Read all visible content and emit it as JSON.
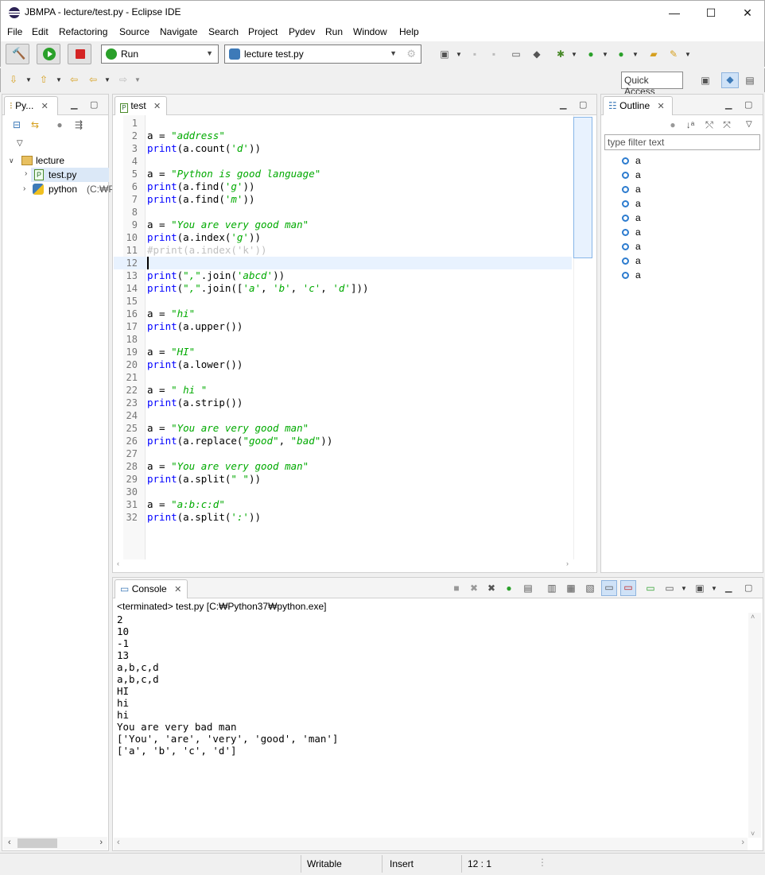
{
  "window": {
    "title": "JBMPA - lecture/test.py - Eclipse IDE",
    "minimize": "—",
    "maximize": "☐",
    "close": "✕"
  },
  "menu": [
    "File",
    "Edit",
    "Refactoring",
    "Source",
    "Navigate",
    "Search",
    "Project",
    "Pydev",
    "Run",
    "Window",
    "Help"
  ],
  "toolbar": {
    "run_config": "Run",
    "launch_target": "lecture test.py",
    "quick_access": "Quick Access"
  },
  "explorer": {
    "tab_label": "Py...",
    "project": "lecture",
    "file": "test.py",
    "interpreter": "python",
    "interpreter_path": "(C:₩P"
  },
  "editor": {
    "tab_label": "test",
    "lines": [
      {
        "n": "1",
        "src": ""
      },
      {
        "n": "2",
        "src": "a = <s>\"address\"</s>"
      },
      {
        "n": "3",
        "src": "<k>print</k>(a.count(<s>'d'</s>))"
      },
      {
        "n": "4",
        "src": ""
      },
      {
        "n": "5",
        "src": "a = <s>\"Python is good language\"</s>"
      },
      {
        "n": "6",
        "src": "<k>print</k>(a.find(<s>'g'</s>))"
      },
      {
        "n": "7",
        "src": "<k>print</k>(a.find(<s>'m'</s>))"
      },
      {
        "n": "8",
        "src": ""
      },
      {
        "n": "9",
        "src": "a = <s>\"You are very good man\"</s>"
      },
      {
        "n": "10",
        "src": "<k>print</k>(a.index(<s>'g'</s>))"
      },
      {
        "n": "11",
        "src": "<c>#print(a.index('k'))</c>"
      },
      {
        "n": "12",
        "src": ""
      },
      {
        "n": "13",
        "src": "<k>print</k>(<s>\",\"</s>.join(<s>'abcd'</s>))"
      },
      {
        "n": "14",
        "src": "<k>print</k>(<s>\",\"</s>.join([<s>'a'</s>, <s>'b'</s>, <s>'c'</s>, <s>'d'</s>]))"
      },
      {
        "n": "15",
        "src": ""
      },
      {
        "n": "16",
        "src": "a = <s>\"hi\"</s>"
      },
      {
        "n": "17",
        "src": "<k>print</k>(a.upper())"
      },
      {
        "n": "18",
        "src": ""
      },
      {
        "n": "19",
        "src": "a = <s>\"HI\"</s>"
      },
      {
        "n": "20",
        "src": "<k>print</k>(a.lower())"
      },
      {
        "n": "21",
        "src": ""
      },
      {
        "n": "22",
        "src": "a = <s>\" hi \"</s>"
      },
      {
        "n": "23",
        "src": "<k>print</k>(a.strip())"
      },
      {
        "n": "24",
        "src": ""
      },
      {
        "n": "25",
        "src": "a = <s>\"You are very good man\"</s>"
      },
      {
        "n": "26",
        "src": "<k>print</k>(a.replace(<s>\"good\"</s>, <s>\"bad\"</s>))"
      },
      {
        "n": "27",
        "src": ""
      },
      {
        "n": "28",
        "src": "a = <s>\"You are very good man\"</s>"
      },
      {
        "n": "29",
        "src": "<k>print</k>(a.split(<s>\" \"</s>))"
      },
      {
        "n": "30",
        "src": ""
      },
      {
        "n": "31",
        "src": "a = <s>\"a:b:c:d\"</s>"
      },
      {
        "n": "32",
        "src": "<k>print</k>(a.split(<s>':'</s>))"
      }
    ],
    "current_line": "12"
  },
  "outline": {
    "tab_label": "Outline",
    "filter_placeholder": "type filter text",
    "items": [
      "a",
      "a",
      "a",
      "a",
      "a",
      "a",
      "a",
      "a",
      "a"
    ]
  },
  "console": {
    "tab_label": "Console",
    "header": "<terminated> test.py [C:₩Python37₩python.exe]",
    "output": [
      "2",
      "10",
      "-1",
      "13",
      "a,b,c,d",
      "a,b,c,d",
      "HI",
      "hi",
      "hi",
      "You are very bad man",
      "['You', 'are', 'very', 'good', 'man']",
      "['a', 'b', 'c', 'd']"
    ]
  },
  "status": {
    "writable": "Writable",
    "insert": "Insert",
    "position": "12 : 1"
  },
  "colors": {
    "keyword": "#0000ff",
    "string": "#00aa00",
    "comment": "#c0c0c0",
    "current_line": "#e8f2fe"
  }
}
